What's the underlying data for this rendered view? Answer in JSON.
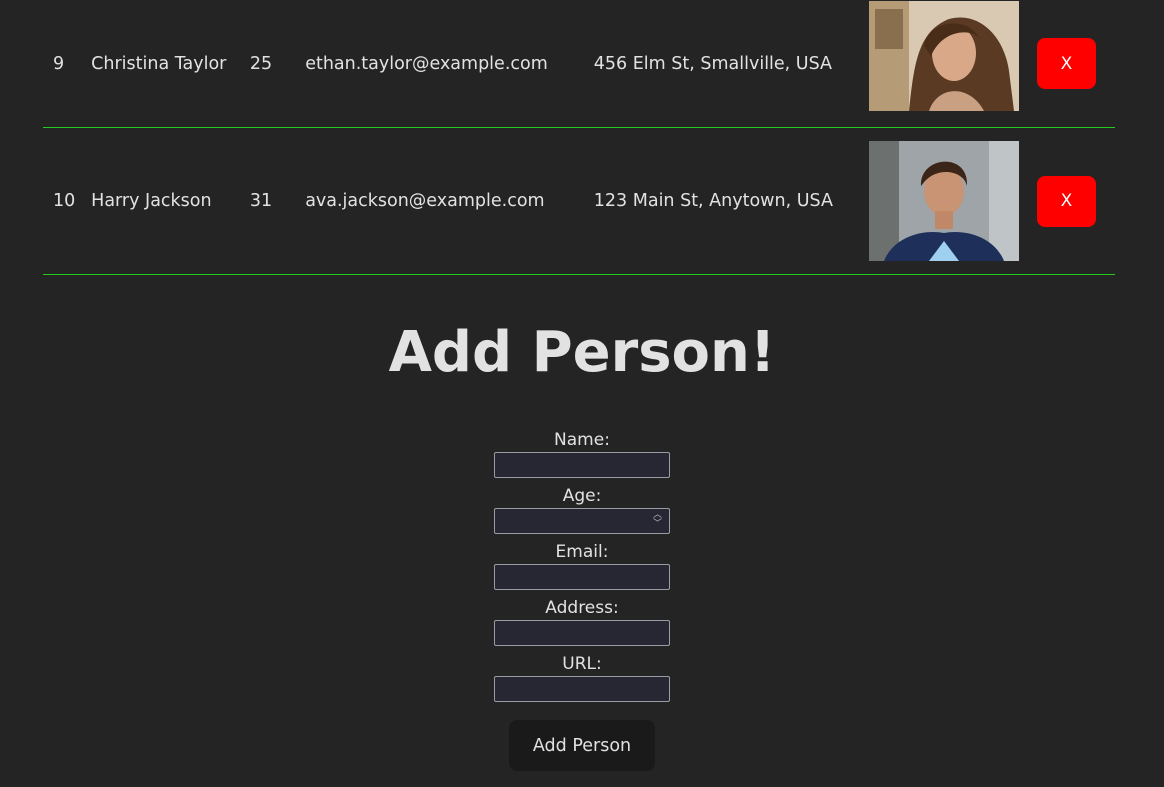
{
  "people": [
    {
      "id": "9",
      "name": "Christina Taylor",
      "age": "25",
      "email": "ethan.taylor@example.com",
      "address": "456 Elm St, Smallville, USA",
      "photo": "portrait-woman-long-brown-hair",
      "delete_label": "X"
    },
    {
      "id": "10",
      "name": "Harry Jackson",
      "age": "31",
      "email": "ava.jackson@example.com",
      "address": "123 Main St, Anytown, USA",
      "photo": "portrait-man-curly-hair-blue-suit",
      "delete_label": "X"
    }
  ],
  "form": {
    "title": "Add Person!",
    "fields": {
      "name_label": "Name:",
      "age_label": "Age:",
      "email_label": "Email:",
      "address_label": "Address:",
      "url_label": "URL:"
    },
    "values": {
      "name": "",
      "age": "",
      "email": "",
      "address": "",
      "url": ""
    },
    "submit_label": "Add Person"
  },
  "colors": {
    "background": "#242424",
    "row_divider": "#22c91f",
    "delete_button": "#ff0000",
    "submit_button": "#1a1a1a",
    "input_background": "#272633"
  }
}
